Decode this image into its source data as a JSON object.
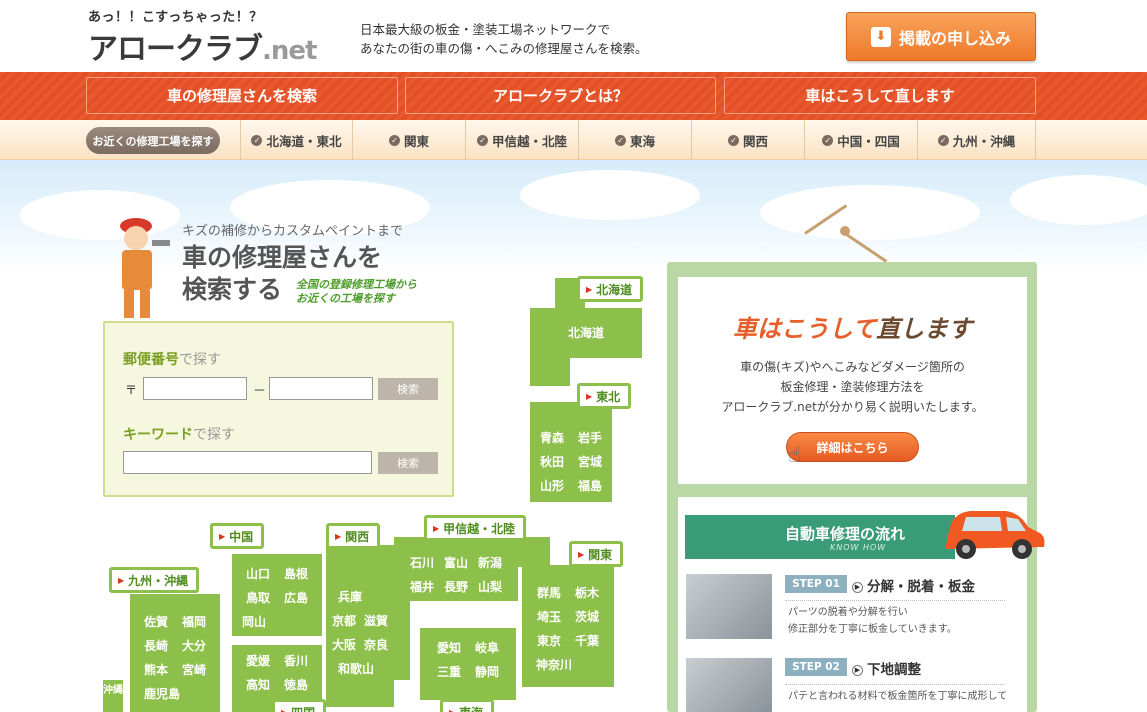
{
  "header": {
    "logo_tag": "あっ！！こすっちゃった！？",
    "logo_main": "アロークラブ",
    "logo_net": ".net",
    "tagline_1": "日本最大級の板金・塗装工場ネットワークで",
    "tagline_2": "あなたの街の車の傷・へこみの修理屋さんを検索。",
    "apply_label": "掲載の申し込み"
  },
  "mainnav": {
    "items": [
      "車の修理屋さんを検索",
      "アロークラブとは？",
      "車はこうして直します"
    ]
  },
  "regionnav": {
    "nearby_label": "お近くの修理工場を探す",
    "items": [
      "北海道・東北",
      "関東",
      "甲信越・北陸",
      "東海",
      "関西",
      "中国・四国",
      "九州・沖縄"
    ]
  },
  "hero": {
    "small": "キズの補修からカスタムペイントまで",
    "big_1": "車の修理屋さんを",
    "big_2": "検索する",
    "green_1": "全国の登録修理工場から",
    "green_2": "お近くの工場を探す"
  },
  "search": {
    "postal_label": "郵便番号",
    "postal_suffix": "で探す",
    "postal_mark": "〒",
    "postal_dash": "－",
    "postal_value_1": "",
    "postal_value_2": "",
    "button_label": "検索",
    "keyword_label": "キーワード",
    "keyword_suffix": "で探す",
    "keyword_value": ""
  },
  "map": {
    "labels": {
      "hokkaido": "北海道",
      "tohoku": "東北",
      "koshinetsu": "甲信越・北陸",
      "kanto": "関東",
      "kansai": "関西",
      "chugoku": "中国",
      "kyushu": "九州・沖縄",
      "shikoku": "四国",
      "tokai": "東海"
    },
    "prefs": {
      "hokkaido": "北海道",
      "tohoku_rows": [
        [
          "青森",
          "岩手"
        ],
        [
          "秋田",
          "宮城"
        ],
        [
          "山形",
          "福島"
        ]
      ],
      "koshinetsu_rows": [
        [
          "石川",
          "富山",
          "新潟"
        ],
        [
          "福井",
          "長野",
          "山梨"
        ]
      ],
      "kanto_rows": [
        [
          "群馬",
          "栃木"
        ],
        [
          "埼玉",
          "茨城"
        ],
        [
          "東京",
          "千葉"
        ],
        [
          "神奈川"
        ]
      ],
      "kansai_rows": [
        [
          "兵庫"
        ],
        [
          "京都",
          "滋賀"
        ],
        [
          "大阪",
          "奈良"
        ],
        [
          "和歌山"
        ]
      ],
      "chugoku_rows": [
        [
          "山口",
          "島根"
        ],
        [
          "鳥取",
          "広島"
        ],
        [
          "岡山"
        ]
      ],
      "shikoku_rows": [
        [
          "愛媛",
          "香川"
        ],
        [
          "高知",
          "徳島"
        ]
      ],
      "tokai_rows": [
        [
          "愛知",
          "岐阜"
        ],
        [
          "三重",
          "静岡"
        ]
      ],
      "kyushu_rows": [
        [
          "佐賀",
          "福岡"
        ],
        [
          "長崎",
          "大分"
        ],
        [
          "熊本",
          "宮崎"
        ],
        [
          "鹿児島"
        ]
      ],
      "okinawa": "沖縄"
    }
  },
  "panel": {
    "title_orange": "車はこうして",
    "title_brown": "直します",
    "desc_1": "車の傷(キズ)やへこみなどダメージ箇所の",
    "desc_2": "板金修理・塗装修理方法を",
    "desc_3": "アロークラブ.netが分かり易く説明いたします。",
    "detail_label": "詳細はこちら",
    "flow_title": "自動車修理の流れ",
    "flow_sub": "KNOW HOW",
    "steps": [
      {
        "badge": "STEP 01",
        "title": "分解・脱着・板金",
        "desc_1": "パーツの脱着や分解を行い",
        "desc_2": "修正部分を丁寧に板金していきます。"
      },
      {
        "badge": "STEP 02",
        "title": "下地調整",
        "desc_1": "パテと言われる材料で板金箇所を丁寧に成形して"
      }
    ]
  },
  "colors": {
    "accent_orange": "#e9592c",
    "map_green": "#8dbf4b",
    "flow_green": "#3a9b78"
  }
}
